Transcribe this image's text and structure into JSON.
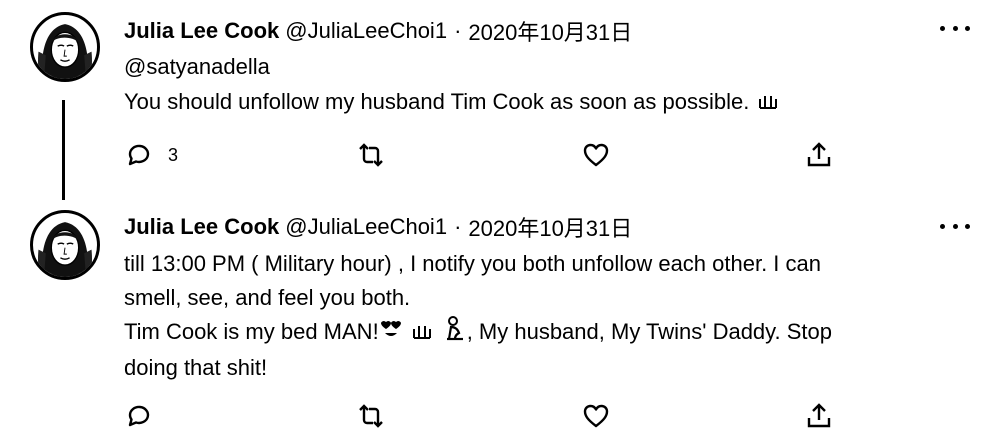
{
  "tweets": [
    {
      "author_name": "Julia Lee Cook",
      "author_handle": "@JuliaLeeChoi1",
      "separator": "·",
      "date": "2020年10月31日",
      "mention": "@satyanadella",
      "text_lines": [
        "You should unfollow my husband Tim Cook as soon as possible."
      ],
      "reply_count": "3"
    },
    {
      "author_name": "Julia Lee Cook",
      "author_handle": "@JuliaLeeChoi1",
      "separator": "·",
      "date": "2020年10月31日",
      "text_lines": [
        "till 13:00 PM ( Military hour) , I notify you both unfollow each other. I can",
        "smell, see, and feel you both.",
        "Tim Cook is my bed MAN!",
        ", My husband, My Twins' Daddy. Stop",
        "doing that shit!"
      ],
      "reply_count": ""
    }
  ],
  "icons": {
    "reply": "reply-icon",
    "retweet": "retweet-icon",
    "like": "heart-icon",
    "share": "share-icon",
    "more": "more-icon"
  }
}
